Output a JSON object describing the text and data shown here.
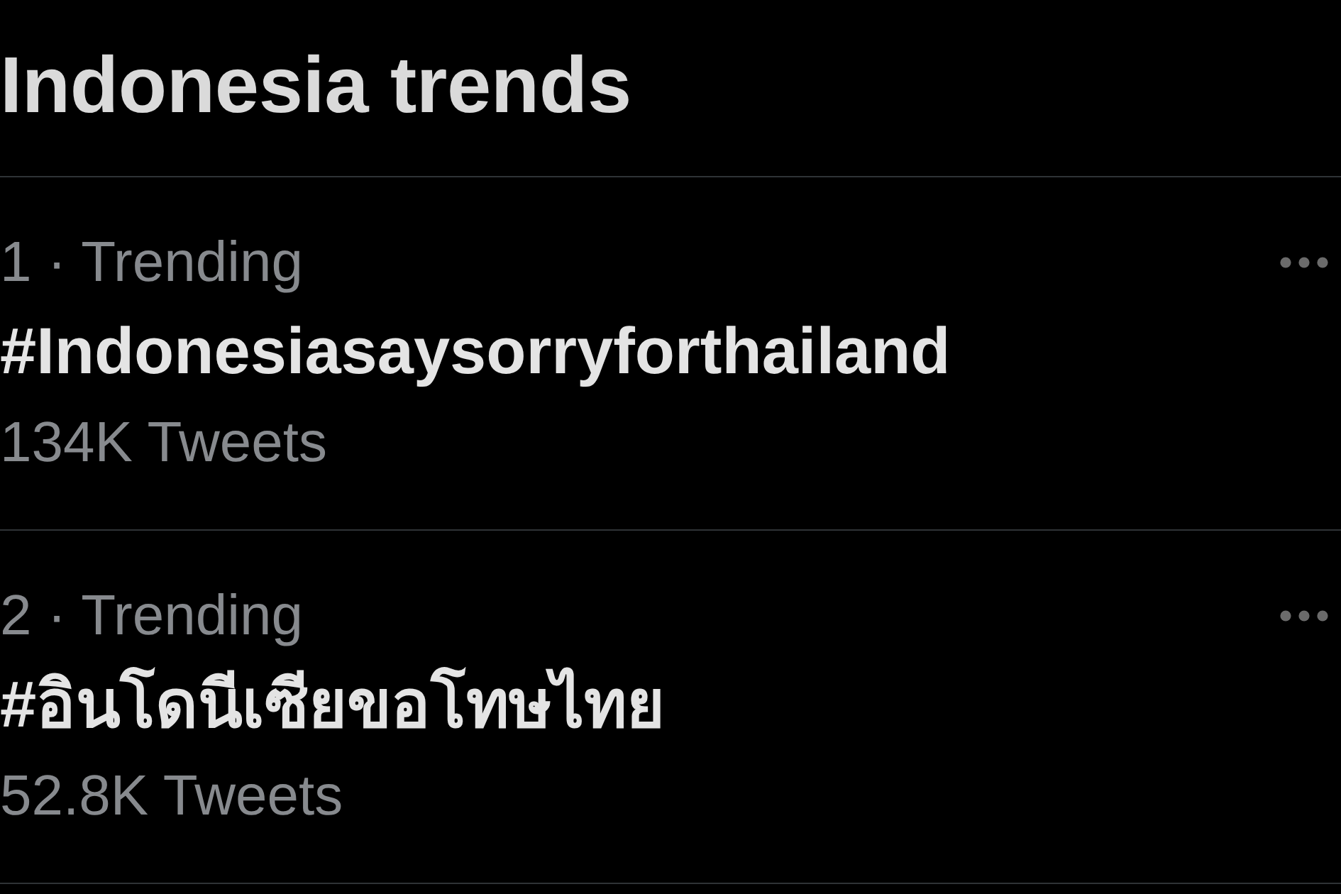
{
  "header": {
    "title": "Indonesia trends"
  },
  "trends": [
    {
      "context": "1 · Trending",
      "name": "#Indonesiasaysorryforthailand",
      "count": "134K Tweets"
    },
    {
      "context": "2 · Trending",
      "name": "#อินโดนีเซียขอโทษไทย",
      "count": "52.8K Tweets"
    }
  ]
}
